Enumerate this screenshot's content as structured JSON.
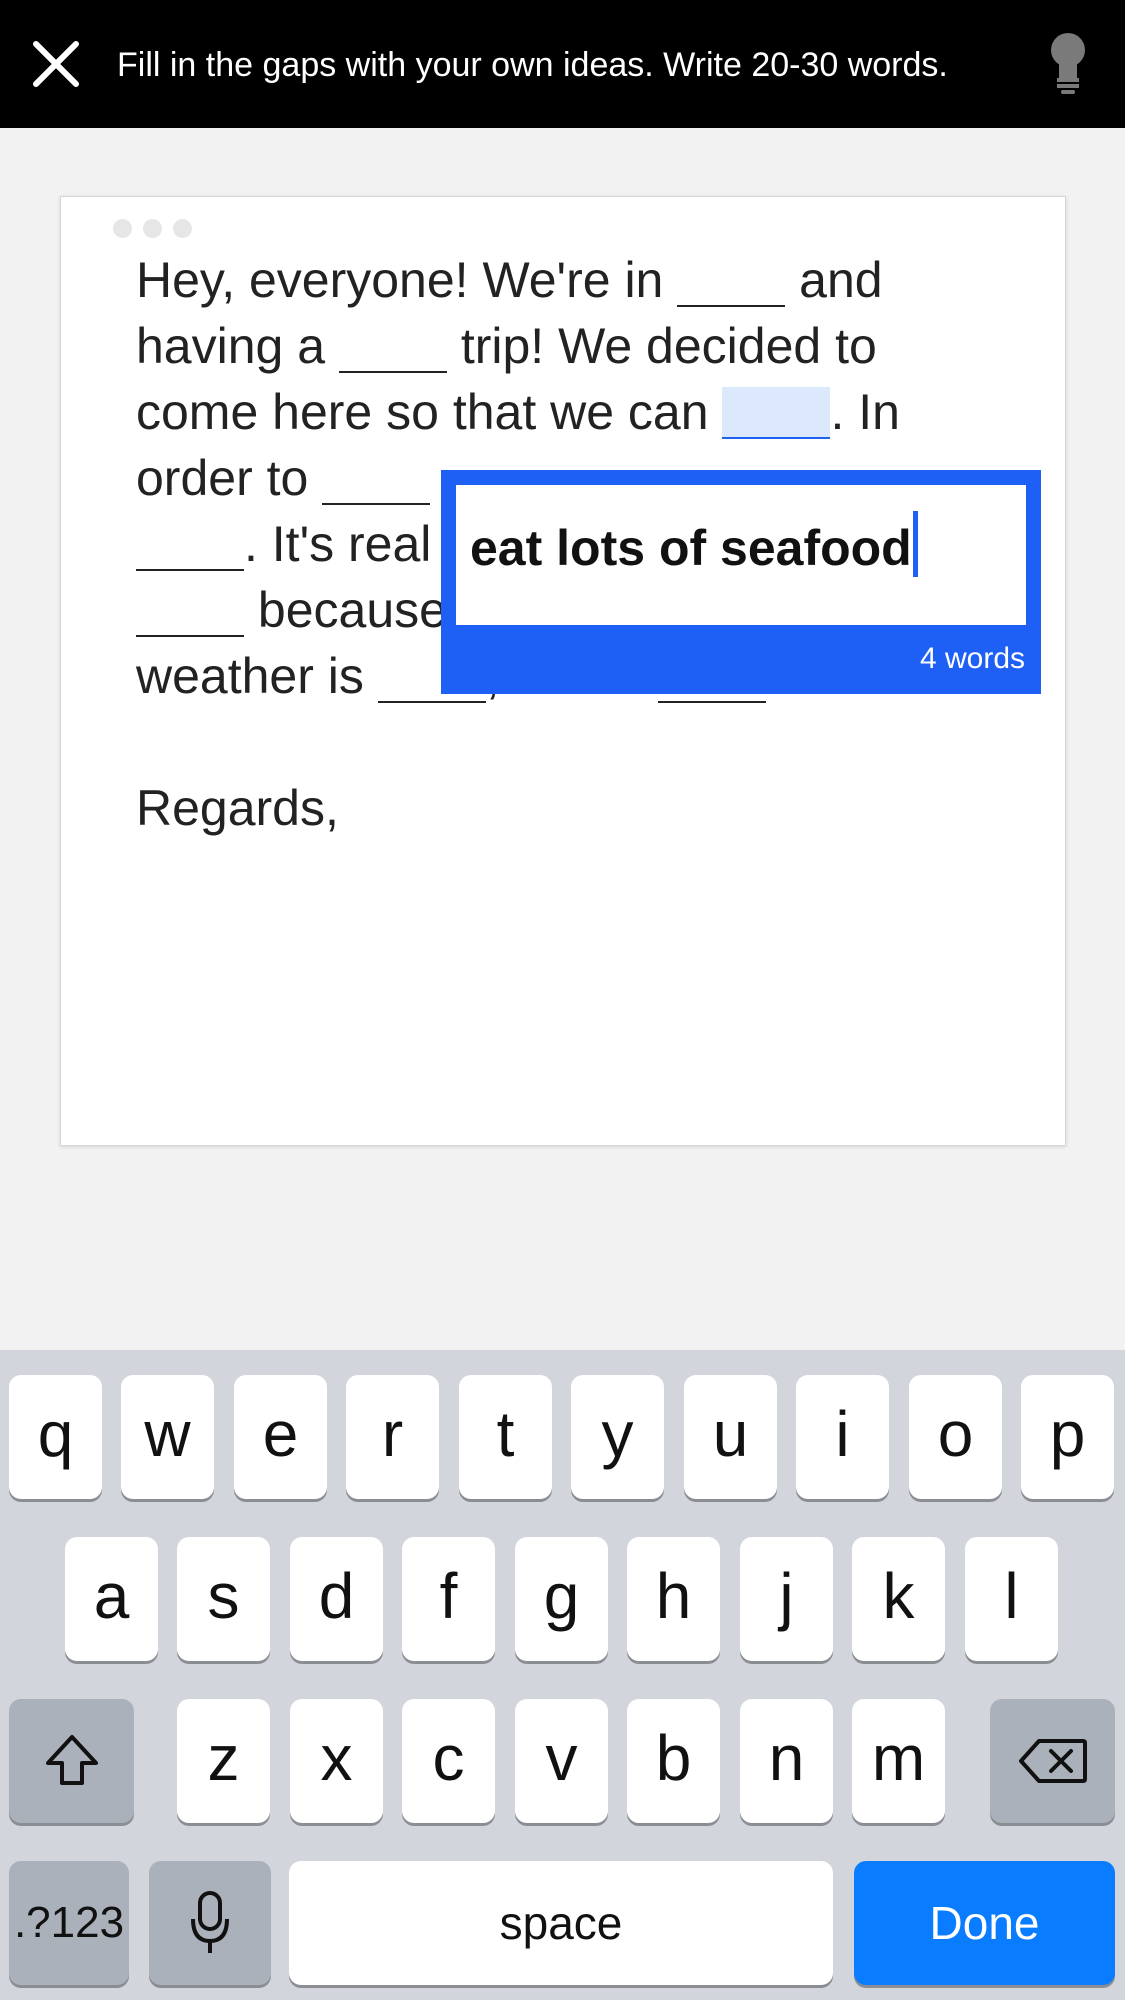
{
  "header": {
    "instructions": "Fill in the gaps with your own ideas. Write 20-30 words.",
    "close_icon": "close-icon",
    "hint_icon": "lightbulb-icon"
  },
  "card": {
    "lines": [
      {
        "before": "Hey, everyone! We're in ",
        "after": " and"
      },
      {
        "before": "having a ",
        "after": " trip! We decided to"
      },
      {
        "before": "come here so that we can ",
        "after": ". In"
      },
      {
        "before": "order to ",
        "after": ""
      },
      {
        "before": "",
        "after": ". It's real"
      },
      {
        "before": "",
        "after": " because"
      },
      {
        "before": "weather is ",
        "middle": ", so we ",
        "after": "."
      }
    ],
    "closing": "Regards,"
  },
  "editor": {
    "value": "eat lots of seafood",
    "word_count": "4 words",
    "accent_color": "#1e5ff5"
  },
  "keyboard": {
    "row1": [
      "q",
      "w",
      "e",
      "r",
      "t",
      "y",
      "u",
      "i",
      "o",
      "p"
    ],
    "row2": [
      "a",
      "s",
      "d",
      "f",
      "g",
      "h",
      "j",
      "k",
      "l"
    ],
    "row3": [
      "z",
      "x",
      "c",
      "v",
      "b",
      "n",
      "m"
    ],
    "shift_icon": "shift-icon",
    "backspace_icon": "backspace-icon",
    "mic_icon": "microphone-icon",
    "numbers_label": ".?123",
    "space_label": "space",
    "done_label": "Done",
    "done_color": "#0a7cff"
  }
}
